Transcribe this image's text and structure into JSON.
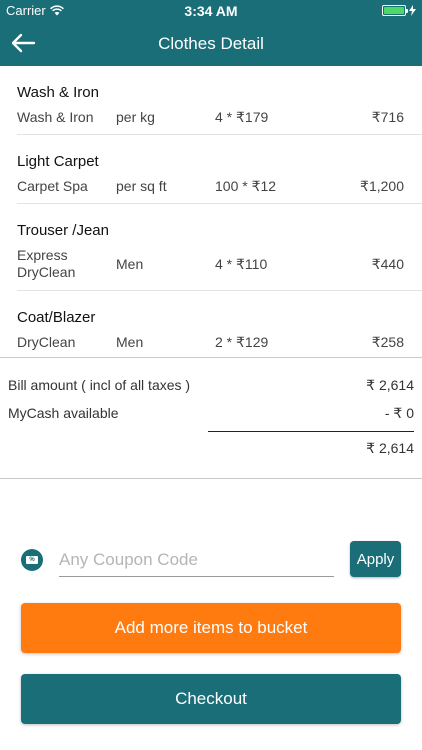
{
  "status_bar": {
    "carrier": "Carrier",
    "time": "3:34 AM"
  },
  "header": {
    "title": "Clothes Detail",
    "back_icon": "arrow-left-icon"
  },
  "items": [
    {
      "title": "Wash & Iron",
      "rows": [
        {
          "service": "Wash & Iron",
          "unit": "per kg",
          "qty": "4 * ₹179",
          "amount": "₹716"
        }
      ]
    },
    {
      "title": "Light Carpet",
      "rows": [
        {
          "service": "Carpet Spa",
          "unit": "per sq ft",
          "qty": "100 * ₹12",
          "amount": "₹1,200"
        }
      ]
    },
    {
      "title": "Trouser /Jean",
      "rows": [
        {
          "service": "Express DryClean",
          "unit": "Men",
          "qty": "4 * ₹110",
          "amount": "₹440"
        }
      ]
    },
    {
      "title": "Coat/Blazer",
      "rows": [
        {
          "service": "DryClean",
          "unit": "Men",
          "qty": "2 * ₹129",
          "amount": "₹258"
        }
      ]
    }
  ],
  "bill": {
    "bill_label": "Bill amount ( incl of all taxes )",
    "bill_value": "₹ 2,614",
    "mycash_label": "MyCash available",
    "mycash_value": "- ₹ 0",
    "total_value": "₹ 2,614"
  },
  "coupon": {
    "placeholder": "Any Coupon Code",
    "value": "",
    "apply_label": "Apply",
    "icon": "coupon-tag-icon",
    "icon_text": "%"
  },
  "actions": {
    "add_more_label": "Add more items to bucket",
    "checkout_label": "Checkout"
  },
  "colors": {
    "primary": "#1a6e78",
    "accent": "#ff7a0f"
  }
}
